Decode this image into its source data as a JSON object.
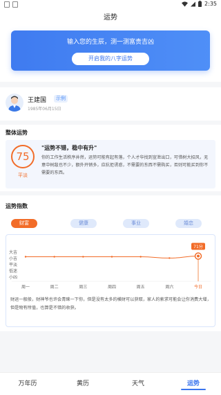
{
  "status": {
    "time": "2:35"
  },
  "header": {
    "title": "运势"
  },
  "hero": {
    "title": "输入您的生辰，测一测富贵吉凶",
    "button": "开启我的八字运势"
  },
  "profile": {
    "name": "王建国",
    "tag": "示例",
    "date": "1985年06月15日"
  },
  "overall": {
    "section_title": "整体运势",
    "score": "75",
    "score_label": "平淡",
    "headline": "\"运势不错，稳中有升\"",
    "body": "你的工作生活秩序井然，运势可能有起有落，个人才华找到宣泄出口，可惜树大招风，无意中树敌也不少，额外开销多，应抗拒诱惑，不需要的东西不需购买，否则可能买到你不需要的东西。"
  },
  "index": {
    "section_title": "运势指数",
    "tabs": [
      {
        "label": "财富"
      },
      {
        "label": "健康"
      },
      {
        "label": "事业"
      },
      {
        "label": "婚恋"
      }
    ],
    "description": "财运一般般，财神爷也许会青睐一下你，但是没有太多的横财可以获取，家人的索求可能会让你消费大增，但是物有所值，也算是不错的收获。"
  },
  "chart_data": {
    "type": "line",
    "categories": [
      "周一",
      "周二",
      "周三",
      "周四",
      "周五",
      "周六",
      "今日"
    ],
    "y_levels": [
      "大吉",
      "小吉",
      "平淡",
      "低迷",
      "小凶"
    ],
    "values": [
      70,
      70,
      70,
      70,
      70,
      68,
      71
    ],
    "ylim": [
      40,
      80
    ],
    "annotation": "71分",
    "highlight_index": 6,
    "color": "#f26c28"
  },
  "bottom_nav": [
    {
      "label": "万年历"
    },
    {
      "label": "黄历"
    },
    {
      "label": "天气"
    },
    {
      "label": "运势"
    }
  ],
  "colors": {
    "accent": "#f26c28",
    "primary": "#3a74ee"
  }
}
